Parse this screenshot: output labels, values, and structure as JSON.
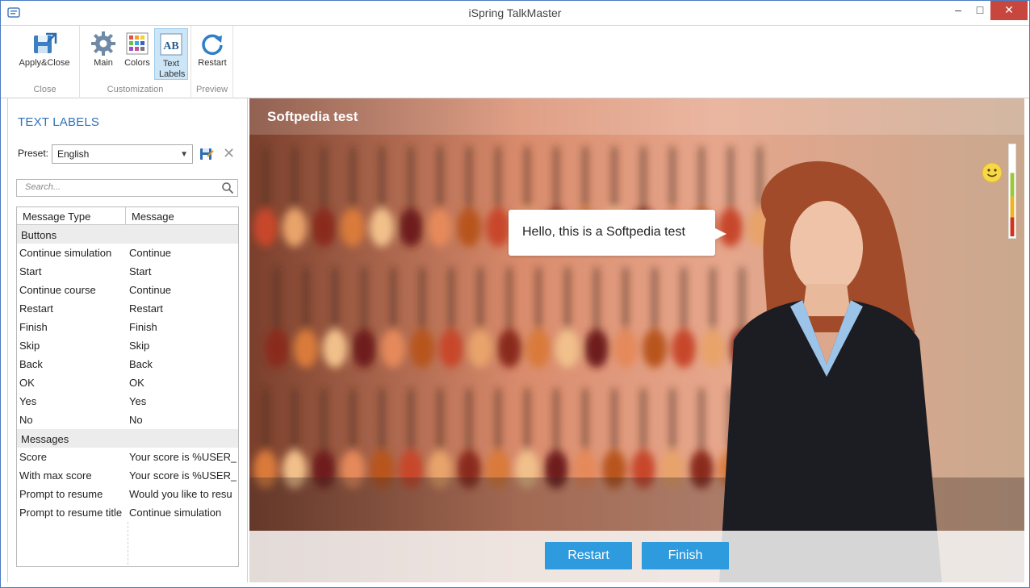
{
  "window": {
    "title": "iSpring TalkMaster",
    "minimize_glyph": "–",
    "maximize_glyph": "□",
    "close_glyph": "✕"
  },
  "ribbon": {
    "groups": [
      {
        "label": "Close",
        "buttons": [
          {
            "label": "Apply&Close",
            "icon": "apply-close-icon"
          }
        ]
      },
      {
        "label": "Customization",
        "buttons": [
          {
            "label": "Main",
            "icon": "gear-icon"
          },
          {
            "label": "Colors",
            "icon": "palette-icon"
          },
          {
            "label": "Text Labels",
            "icon": "text-labels-icon",
            "active": true
          }
        ]
      },
      {
        "label": "Preview",
        "buttons": [
          {
            "label": "Restart",
            "icon": "restart-icon"
          }
        ]
      }
    ]
  },
  "left_panel": {
    "title": "TEXT LABELS",
    "preset_label": "Preset:",
    "preset_value": "English",
    "search_placeholder": "Search...",
    "columns": [
      "Message Type",
      "Message"
    ],
    "groups": [
      {
        "name": "Buttons",
        "rows": [
          [
            "Continue simulation",
            "Continue"
          ],
          [
            "Start",
            "Start"
          ],
          [
            "Continue course",
            "Continue"
          ],
          [
            "Restart",
            "Restart"
          ],
          [
            "Finish",
            "Finish"
          ],
          [
            "Skip",
            "Skip"
          ],
          [
            "Back",
            "Back"
          ],
          [
            "OK",
            "OK"
          ],
          [
            "Yes",
            "Yes"
          ],
          [
            "No",
            "No"
          ]
        ]
      },
      {
        "name": "Messages",
        "rows": [
          [
            "Score",
            "Your score is %USER_S"
          ],
          [
            "With max score",
            "Your score is %USER_S"
          ],
          [
            "Prompt to resume",
            "Would you like to resu"
          ],
          [
            "Prompt to resume title",
            "Continue simulation"
          ]
        ]
      }
    ]
  },
  "preview": {
    "topic_title": "Softpedia test",
    "bubble_text": "Hello, this is a Softpedia test",
    "restart_label": "Restart",
    "finish_label": "Finish",
    "accent_color": "#2e9bde"
  }
}
